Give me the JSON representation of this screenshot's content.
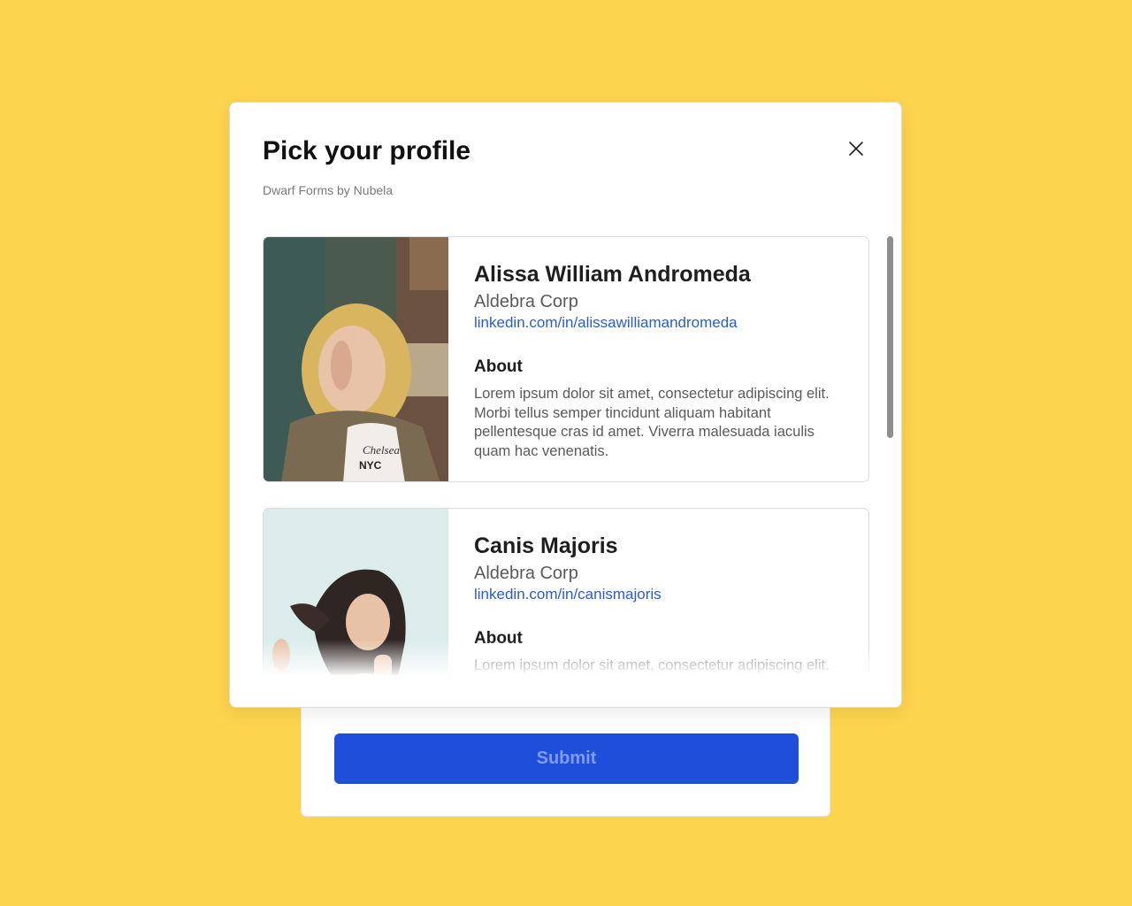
{
  "modal": {
    "title": "Pick your profile",
    "subtitle": "Dwarf Forms by Nubela",
    "close_icon": "close-icon"
  },
  "profiles": [
    {
      "name": "Alissa William Andromeda",
      "company": "Aldebra Corp",
      "linkedin": "linkedin.com/in/alissawilliamandromeda",
      "about_label": "About",
      "about_text": "Lorem ipsum dolor sit amet, consectetur adipiscing elit. Morbi tellus semper tincidunt aliquam habitant pellentesque cras id amet. Viverra malesuada iaculis quam hac venenatis."
    },
    {
      "name": "Canis Majoris",
      "company": "Aldebra Corp",
      "linkedin": "linkedin.com/in/canismajoris",
      "about_label": "About",
      "about_text": "Lorem ipsum dolor sit amet, consectetur adipiscing elit. Morbi tellus semper tincidunt aliquam habitant"
    }
  ],
  "form": {
    "submit_label": "Submit"
  },
  "colors": {
    "background": "#FDD44E",
    "accent": "#1F4EDB",
    "link": "#2A5BD7"
  }
}
